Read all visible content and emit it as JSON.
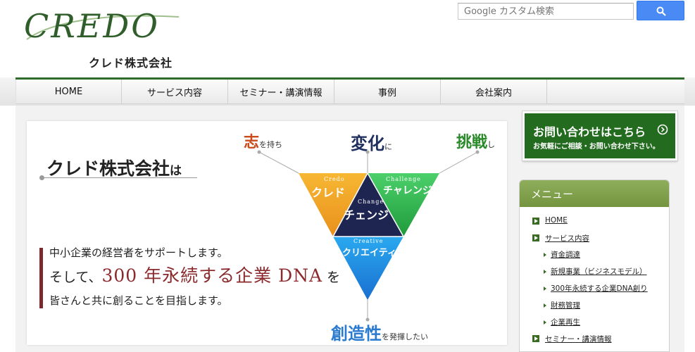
{
  "brand": {
    "logo_text": "CREDO",
    "company_name": "クレド株式会社"
  },
  "search": {
    "placeholder": "Google カスタム検索"
  },
  "nav": {
    "items": [
      "HOME",
      "サービス内容",
      "セミナー・講演情報",
      "事例",
      "会社案内"
    ]
  },
  "hero": {
    "title": "クレド株式会社",
    "title_suffix": "は",
    "keywords": {
      "kokorozashi": "志",
      "kokorozashi_suffix": "を持ち",
      "henka": "変化",
      "henka_suffix": "に",
      "chosen": "挑戦",
      "chosen_suffix": "し",
      "sozo": "創造性",
      "sozo_suffix": "を発揮したい"
    },
    "triangle": {
      "credo_en": "Credo",
      "credo_ja": "クレド",
      "challenge_en": "Challenge",
      "challenge_ja": "チャレンジ",
      "change_en": "Change",
      "change_ja": "チェンジ",
      "creative_en": "Creative",
      "creative_ja": "クリエイティブ"
    },
    "message_line1": "中小企業の経営者をサポートします。",
    "message_line2_prefix": "そして、",
    "message_line2_emphasis": "300 年永続する企業 DNA",
    "message_line2_suffix": "を",
    "message_line3": "皆さんと共に創ることを目指します。"
  },
  "contact": {
    "main": "お問い合わせはこちら",
    "sub": "お気軽にご相談・お問い合わせ下さい。"
  },
  "menu": {
    "heading": "メニュー",
    "items": [
      {
        "label": "HOME",
        "level": 1
      },
      {
        "label": "サービス内容",
        "level": 1
      },
      {
        "label": "資金調達",
        "level": 2
      },
      {
        "label": "新規事業（ビジネスモデル）",
        "level": 2
      },
      {
        "label": "300年永続する企業DNA創り",
        "level": 2
      },
      {
        "label": "財務管理",
        "level": 2
      },
      {
        "label": "企業再生",
        "level": 2
      },
      {
        "label": "セミナー・講演情報",
        "level": 1
      }
    ]
  },
  "colors": {
    "brand_green": "#2f6b2a",
    "accent_red": "#8a2a2c",
    "menu_green": "#74943f",
    "search_blue": "#4a8af4"
  }
}
